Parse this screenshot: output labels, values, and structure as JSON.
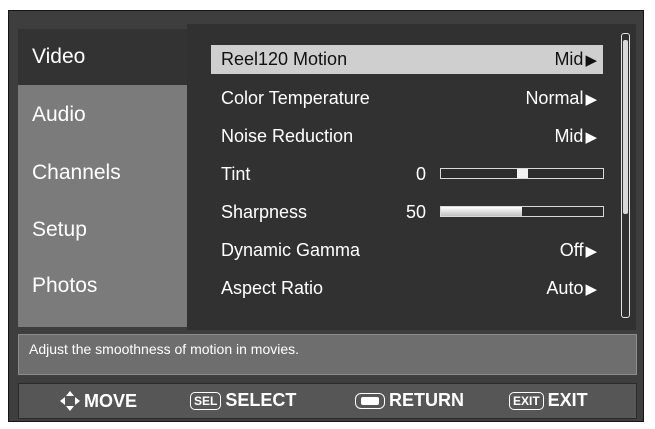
{
  "sidebar": {
    "items": [
      {
        "label": "Video",
        "active": true
      },
      {
        "label": "Audio",
        "active": false
      },
      {
        "label": "Channels",
        "active": false
      },
      {
        "label": "Setup",
        "active": false
      },
      {
        "label": "Photos",
        "active": false
      }
    ]
  },
  "settings": [
    {
      "label": "Reel120 Motion",
      "value": "Mid",
      "type": "select",
      "highlighted": true
    },
    {
      "label": "Color Temperature",
      "value": "Normal",
      "type": "select"
    },
    {
      "label": "Noise Reduction",
      "value": "Mid",
      "type": "select"
    },
    {
      "label": "Tint",
      "value": "0",
      "type": "slider",
      "slider_style": "centered"
    },
    {
      "label": "Sharpness",
      "value": "50",
      "type": "slider",
      "level": 0.5
    },
    {
      "label": "Dynamic Gamma",
      "value": "Off",
      "type": "select"
    },
    {
      "label": "Aspect Ratio",
      "value": "Auto",
      "type": "select"
    }
  ],
  "help_text": "Adjust the smoothness of motion in movies.",
  "buttons": {
    "move": {
      "label": "MOVE",
      "icon": "dpad-icon"
    },
    "select": {
      "key": "SEL",
      "label": "SELECT"
    },
    "return": {
      "label": "RETURN",
      "icon": "return-key-icon"
    },
    "exit": {
      "key": "EXIT",
      "label": "EXIT"
    }
  },
  "colors": {
    "highlight": "#cfcfcf",
    "panel": "#313131",
    "sidebar": "#7b7b7b"
  }
}
